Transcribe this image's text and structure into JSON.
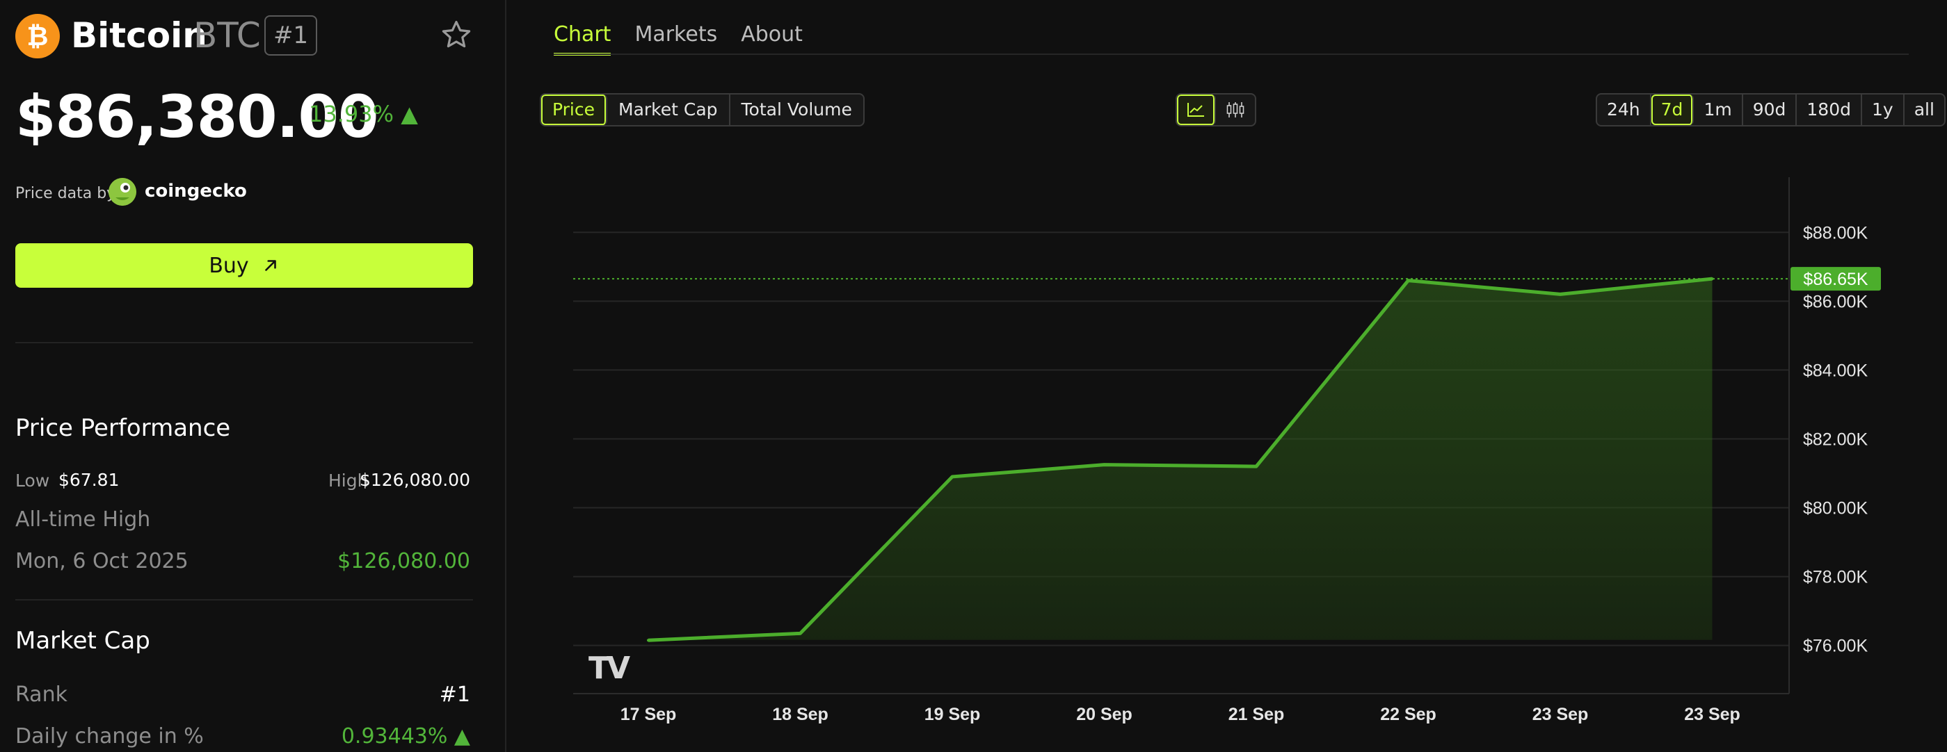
{
  "coin": {
    "icon_glyph": "₿",
    "name": "Bitcoin",
    "symbol": "BTC",
    "rank_badge": "#1",
    "price": "$86,380.00",
    "change": "13.93% ▲",
    "price_data_by": "Price data by",
    "provider": "coingecko"
  },
  "buy": {
    "label": "Buy"
  },
  "performance": {
    "heading": "Price Performance",
    "low_label": "Low",
    "low_value": "$67.81",
    "high_label": "High",
    "high_value": "$126,080.00",
    "ath_label": "All-time High",
    "ath_date": "Mon, 6 Oct 2025",
    "ath_value": "$126,080.00"
  },
  "market_cap": {
    "heading": "Market Cap",
    "rank_label": "Rank",
    "rank_value": "#1",
    "daily_label": "Daily change in %",
    "daily_value": "0.93443% ▲"
  },
  "tabs": [
    {
      "label": "Chart",
      "active": true
    },
    {
      "label": "Markets",
      "active": false
    },
    {
      "label": "About",
      "active": false
    }
  ],
  "metric_toggle": [
    "Price",
    "Market Cap",
    "Total Volume"
  ],
  "metric_active": "Price",
  "view_toggle": [
    "line-chart-icon",
    "candlestick-icon"
  ],
  "view_active": "line-chart-icon",
  "range_toggle": [
    "24h",
    "7d",
    "1m",
    "90d",
    "180d",
    "1y",
    "all"
  ],
  "range_active": "7d",
  "colors": {
    "accent": "#c8ff3a",
    "positive": "#52b53a",
    "line": "#4cae2c",
    "background": "#101010"
  },
  "chart_data": {
    "type": "area",
    "categories": [
      "17 Sep",
      "18 Sep",
      "19 Sep",
      "20 Sep",
      "21 Sep",
      "22 Sep",
      "23 Sep",
      "23 Sep"
    ],
    "series": [
      {
        "values": [
          76150,
          76350,
          80900,
          81250,
          81200,
          86600,
          86200,
          86650
        ]
      }
    ],
    "y_ticks": [
      "$88.00K",
      "$86.00K",
      "$84.00K",
      "$82.00K",
      "$80.00K",
      "$78.00K",
      "$76.00K"
    ],
    "y_tick_values": [
      88000,
      86000,
      84000,
      82000,
      80000,
      78000,
      76000
    ],
    "ylim": [
      74600,
      89600
    ],
    "current_label": "$86.65K",
    "current_value": 86650,
    "grid": true,
    "watermark": "TV"
  }
}
